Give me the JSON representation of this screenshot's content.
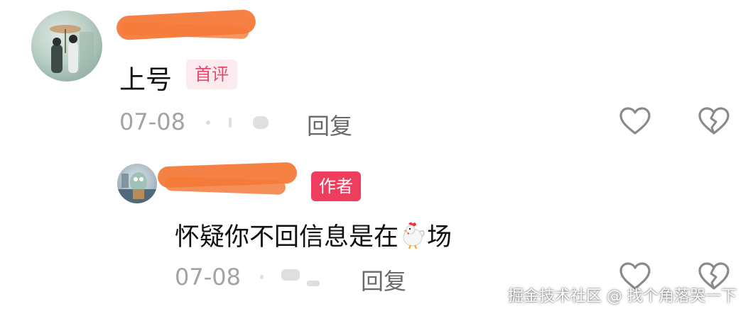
{
  "comments": [
    {
      "text": "上号",
      "badge": "首评",
      "date": "07-08",
      "reply_label": "回复"
    },
    {
      "text_before_emoji": "怀疑你不回信息是在",
      "emoji": "rooster-emoji",
      "text_after_emoji": "场",
      "badge": "作者",
      "date": "07-08",
      "reply_label": "回复"
    }
  ],
  "icons": {
    "like": "heart-outline-icon",
    "dislike": "broken-heart-outline-icon"
  },
  "watermark": "掘金技术社区 @ 找个角落哭一下",
  "colors": {
    "first_badge_text": "#e8466a",
    "first_badge_bg": "#fdecef",
    "author_badge_bg": "#ef3d5e",
    "redaction": "#f57a3a",
    "icon_stroke": "#8a8a8a"
  }
}
